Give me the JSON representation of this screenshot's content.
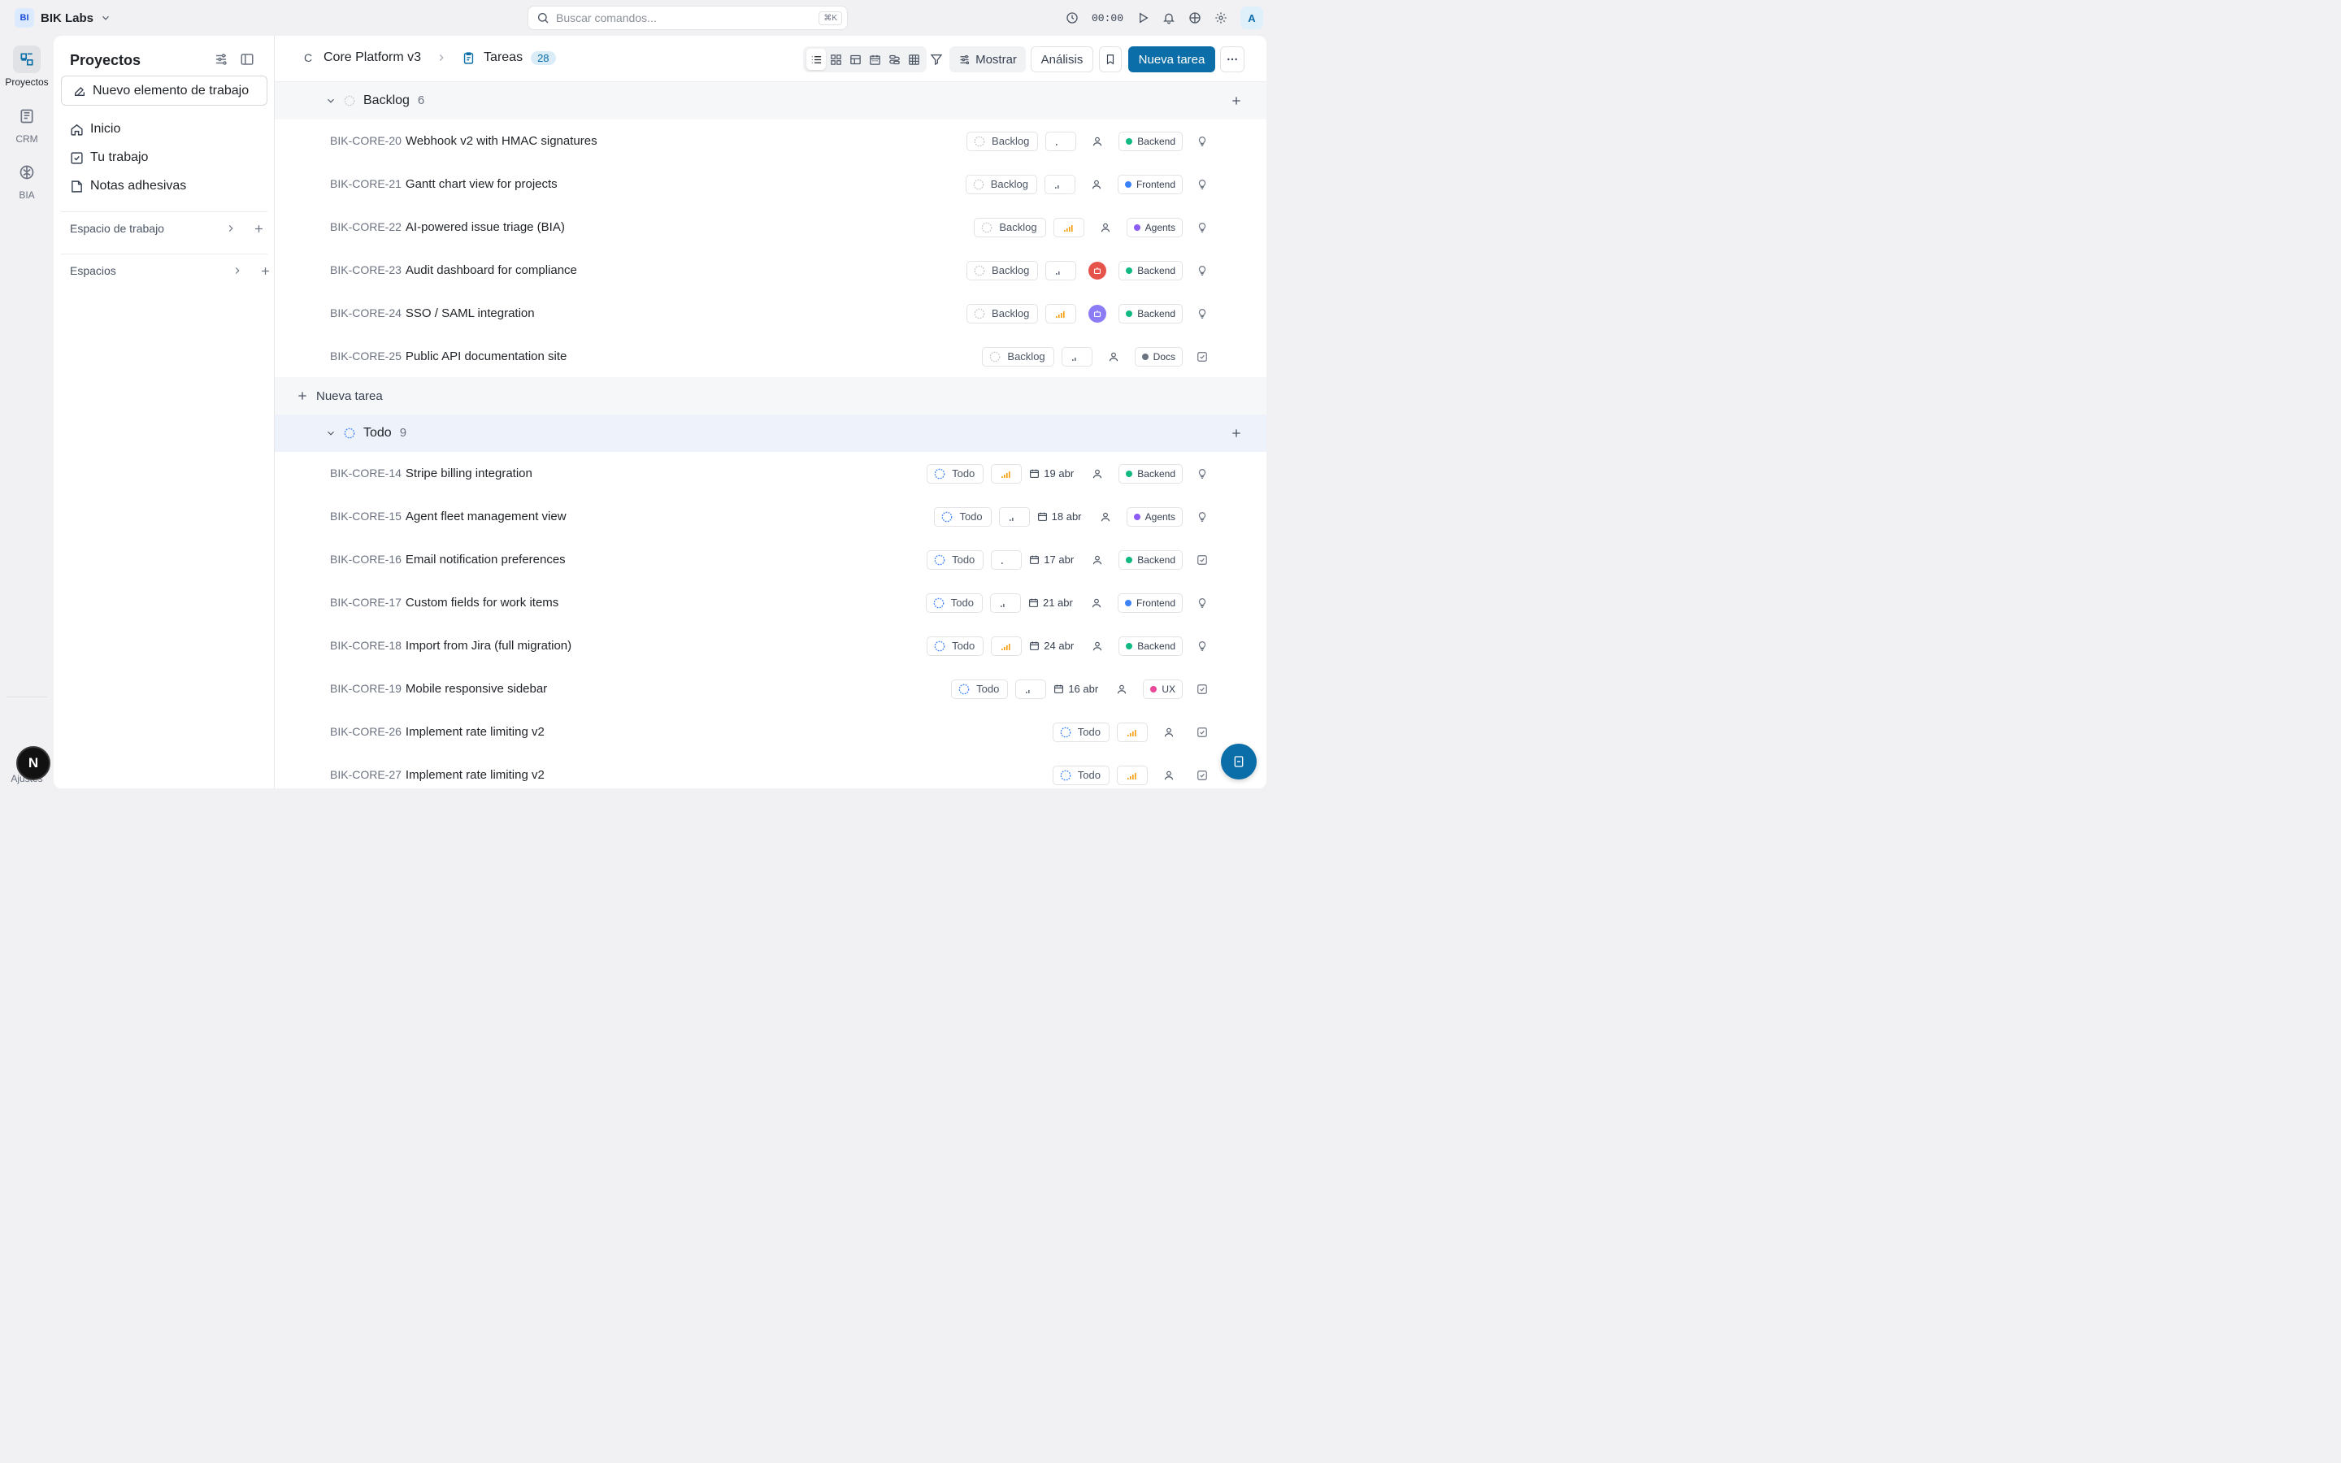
{
  "workspace": {
    "initials": "BI",
    "name": "BIK Labs"
  },
  "search": {
    "placeholder": "Buscar comandos...",
    "shortcut": "⌘K"
  },
  "timer": "00:00",
  "user_avatar": "A",
  "rail": {
    "items": [
      {
        "label": "Proyectos",
        "icon": "projects-icon",
        "active": true
      },
      {
        "label": "CRM",
        "icon": "crm-icon",
        "active": false
      },
      {
        "label": "BIA",
        "icon": "brain-icon",
        "active": false
      }
    ],
    "settings_label": "Ajustes",
    "badge": "N"
  },
  "sidebar": {
    "title": "Proyectos",
    "new_item": "Nuevo elemento de trabajo",
    "nav": [
      {
        "label": "Inicio",
        "icon": "home-icon"
      },
      {
        "label": "Tu trabajo",
        "icon": "check-square-icon"
      },
      {
        "label": "Notas adhesivas",
        "icon": "sticky-note-icon"
      }
    ],
    "sections": [
      {
        "label": "Espacio de trabajo"
      },
      {
        "label": "Espacios"
      }
    ]
  },
  "header": {
    "project_initial": "C",
    "project_name": "Core Platform v3",
    "section": "Tareas",
    "count": "28",
    "show_label": "Mostrar",
    "analysis_label": "Análisis",
    "new_task_label": "Nueva tarea"
  },
  "colors": {
    "accent": "#0b6ea8",
    "backend": "#10b981",
    "frontend": "#3b82f6",
    "agents": "#8b5cf6",
    "docs": "#6b7280",
    "ux": "#ec4899",
    "priority_high": "#f59e0b",
    "bot_red": "#e5534b",
    "bot_purple": "#8b7cf6"
  },
  "groups": [
    {
      "name": "Backlog",
      "count": "6",
      "tasks": [
        {
          "id": "BIK-CORE-20",
          "title": "Webhook v2 with HMAC signatures",
          "status": "Backlog",
          "priority": "low",
          "date": "",
          "assignee": "user",
          "label": "Backend",
          "label_color": "#10b981",
          "type": "idea"
        },
        {
          "id": "BIK-CORE-21",
          "title": "Gantt chart view for projects",
          "status": "Backlog",
          "priority": "medium",
          "date": "",
          "assignee": "user",
          "label": "Frontend",
          "label_color": "#3b82f6",
          "type": "idea"
        },
        {
          "id": "BIK-CORE-22",
          "title": "AI-powered issue triage (BIA)",
          "status": "Backlog",
          "priority": "high",
          "date": "",
          "assignee": "user",
          "label": "Agents",
          "label_color": "#8b5cf6",
          "type": "idea"
        },
        {
          "id": "BIK-CORE-23",
          "title": "Audit dashboard for compliance",
          "status": "Backlog",
          "priority": "medium",
          "date": "",
          "assignee": "bot-red",
          "label": "Backend",
          "label_color": "#10b981",
          "type": "idea"
        },
        {
          "id": "BIK-CORE-24",
          "title": "SSO / SAML integration",
          "status": "Backlog",
          "priority": "high",
          "date": "",
          "assignee": "bot-purple",
          "label": "Backend",
          "label_color": "#10b981",
          "type": "idea"
        },
        {
          "id": "BIK-CORE-25",
          "title": "Public API documentation site",
          "status": "Backlog",
          "priority": "medium",
          "date": "",
          "assignee": "user",
          "label": "Docs",
          "label_color": "#6b7280",
          "type": "task"
        }
      ]
    },
    {
      "name": "Todo",
      "count": "9",
      "tasks": [
        {
          "id": "BIK-CORE-14",
          "title": "Stripe billing integration",
          "status": "Todo",
          "priority": "high",
          "date": "19 abr",
          "assignee": "user",
          "label": "Backend",
          "label_color": "#10b981",
          "type": "idea"
        },
        {
          "id": "BIK-CORE-15",
          "title": "Agent fleet management view",
          "status": "Todo",
          "priority": "medium",
          "date": "18 abr",
          "assignee": "user",
          "label": "Agents",
          "label_color": "#8b5cf6",
          "type": "idea"
        },
        {
          "id": "BIK-CORE-16",
          "title": "Email notification preferences",
          "status": "Todo",
          "priority": "low",
          "date": "17 abr",
          "assignee": "user",
          "label": "Backend",
          "label_color": "#10b981",
          "type": "task"
        },
        {
          "id": "BIK-CORE-17",
          "title": "Custom fields for work items",
          "status": "Todo",
          "priority": "medium",
          "date": "21 abr",
          "assignee": "user",
          "label": "Frontend",
          "label_color": "#3b82f6",
          "type": "idea"
        },
        {
          "id": "BIK-CORE-18",
          "title": "Import from Jira (full migration)",
          "status": "Todo",
          "priority": "high",
          "date": "24 abr",
          "assignee": "user",
          "label": "Backend",
          "label_color": "#10b981",
          "type": "idea"
        },
        {
          "id": "BIK-CORE-19",
          "title": "Mobile responsive sidebar",
          "status": "Todo",
          "priority": "medium",
          "date": "16 abr",
          "assignee": "user",
          "label": "UX",
          "label_color": "#ec4899",
          "type": "task"
        },
        {
          "id": "BIK-CORE-26",
          "title": "Implement rate limiting v2",
          "status": "Todo",
          "priority": "high",
          "date": "",
          "assignee": "user",
          "label": "",
          "label_color": "",
          "type": "task"
        },
        {
          "id": "BIK-CORE-27",
          "title": "Implement rate limiting v2",
          "status": "Todo",
          "priority": "high",
          "date": "",
          "assignee": "user",
          "label": "",
          "label_color": "",
          "type": "task"
        }
      ]
    }
  ],
  "new_task_inline": "Nueva tarea"
}
